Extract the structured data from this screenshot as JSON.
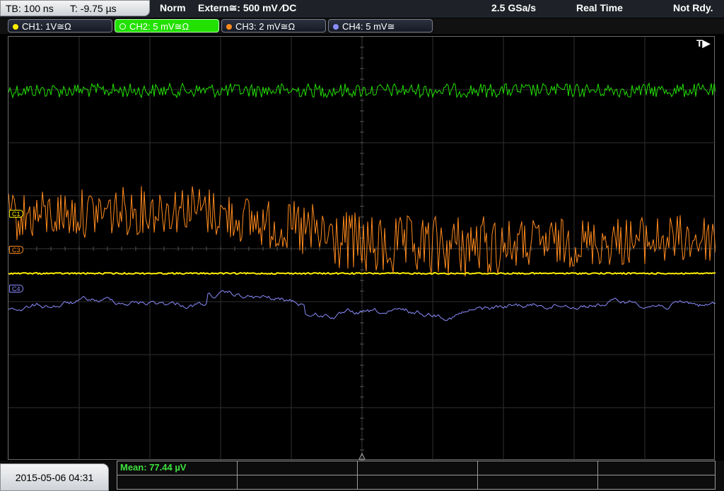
{
  "header": {
    "timebase": "TB: 100 ns",
    "trigger_time": "T: -9.75 µs",
    "trigger_mode": "Norm",
    "trigger_source": "Extern≅: 500 mV ⁄DC",
    "sample_rate": "2.5 GSa/s",
    "acquire_mode": "Real Time",
    "status": "Not Rdy."
  },
  "channels": [
    {
      "label": "CH1: 1V≅Ω",
      "color": "#ffee00"
    },
    {
      "label": "CH2: 5 mV≅Ω",
      "color": "#22e000",
      "active": true
    },
    {
      "label": "CH3: 2 mV≅Ω",
      "color": "#ff8a1e"
    },
    {
      "label": "CH4: 5 mV≅",
      "color": "#8a8cff"
    }
  ],
  "markers": {
    "ch1": "C1",
    "ch3": "C3",
    "ch4": "C4",
    "trigger": "T▶"
  },
  "footer": {
    "datetime": "2015-05-06 04:31",
    "mean": "Mean: 77.44 µV"
  }
}
